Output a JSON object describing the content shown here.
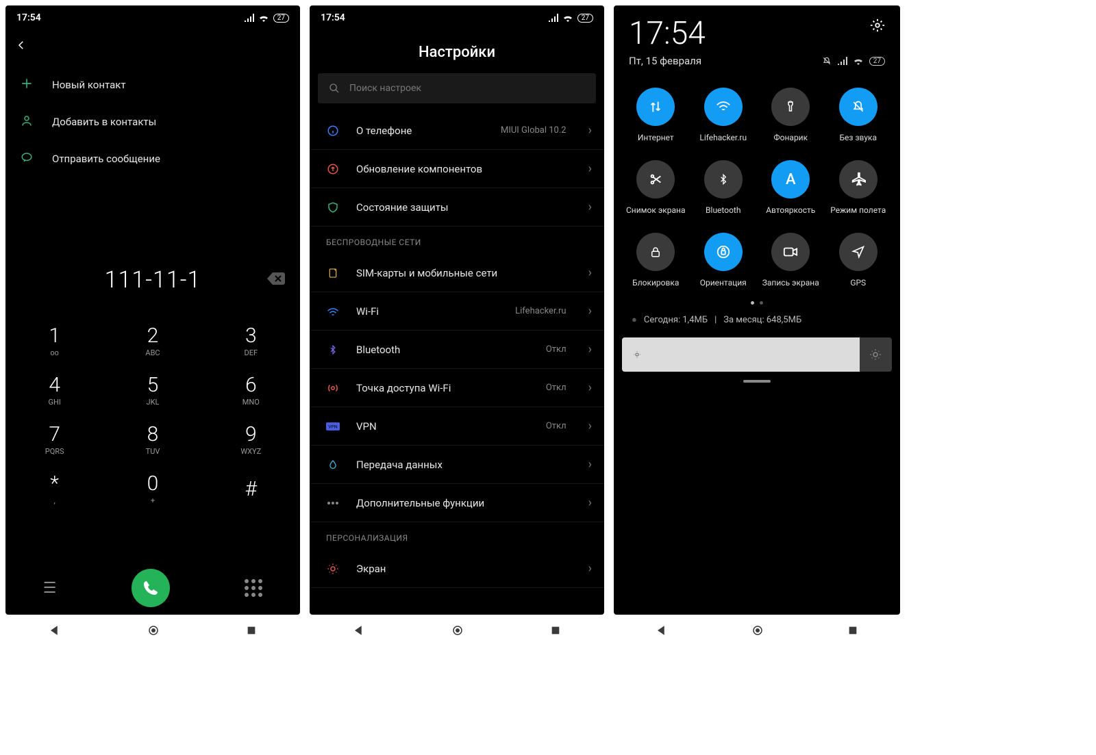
{
  "status": {
    "time": "17:54",
    "battery": "27"
  },
  "dialer": {
    "actions": {
      "new_contact": "Новый контакт",
      "add_contacts": "Добавить в контакты",
      "send_message": "Отправить сообщение"
    },
    "number": "111-11-1",
    "keys": [
      {
        "d": "1",
        "l": "ᴏᴏ"
      },
      {
        "d": "2",
        "l": "ABC"
      },
      {
        "d": "3",
        "l": "DEF"
      },
      {
        "d": "4",
        "l": "GHI"
      },
      {
        "d": "5",
        "l": "JKL"
      },
      {
        "d": "6",
        "l": "MNO"
      },
      {
        "d": "7",
        "l": "PQRS"
      },
      {
        "d": "8",
        "l": "TUV"
      },
      {
        "d": "9",
        "l": "WXYZ"
      },
      {
        "d": "*",
        "l": ","
      },
      {
        "d": "0",
        "l": "+"
      },
      {
        "d": "#",
        "l": ""
      }
    ]
  },
  "settings": {
    "title": "Настройки",
    "search_placeholder": "Поиск настроек",
    "section_wireless": "БЕСПРОВОДНЫЕ СЕТИ",
    "section_personalization": "ПЕРСОНАЛИЗАЦИЯ",
    "rows": {
      "about": {
        "label": "О телефоне",
        "value": "MIUI Global 10.2"
      },
      "update": {
        "label": "Обновление компонентов",
        "value": ""
      },
      "security": {
        "label": "Состояние защиты",
        "value": ""
      },
      "sim": {
        "label": "SIM-карты и мобильные сети",
        "value": ""
      },
      "wifi": {
        "label": "Wi-Fi",
        "value": "Lifehacker.ru"
      },
      "bt": {
        "label": "Bluetooth",
        "value": "Откл"
      },
      "hotspot": {
        "label": "Точка доступа Wi-Fi",
        "value": "Откл"
      },
      "vpn": {
        "label": "VPN",
        "value": "Откл"
      },
      "data": {
        "label": "Передача данных",
        "value": ""
      },
      "more": {
        "label": "Дополнительные функции",
        "value": ""
      },
      "display": {
        "label": "Экран",
        "value": ""
      }
    }
  },
  "qs": {
    "clock": "17:54",
    "date": "Пт, 15 февраля",
    "battery": "27",
    "tiles": {
      "internet": "Интернет",
      "wifi": "Lifehacker.ru",
      "torch": "Фонарик",
      "silent": "Без звука",
      "screenshot": "Снимок экрана",
      "bluetooth": "Bluetooth",
      "autobright": "Автояркость",
      "airplane": "Режим полета",
      "lock": "Блокировка",
      "rotation": "Ориентация",
      "screenrec": "Запись экрана",
      "gps": "GPS"
    },
    "data_today": "Сегодня: 1,4МБ",
    "data_month": "За месяц: 648,5МБ"
  }
}
